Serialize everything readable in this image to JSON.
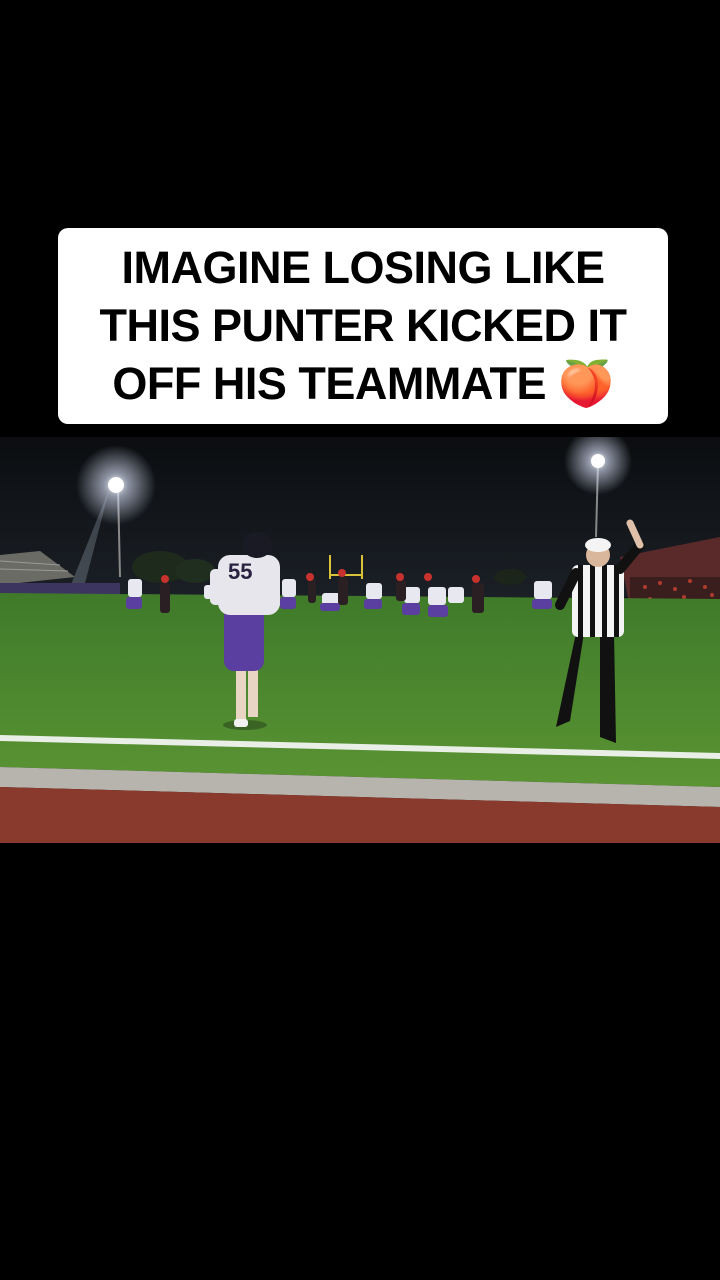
{
  "caption": {
    "text": "IMAGINE LOSING LIKE\nTHIS PUNTER KICKED IT\nOFF HIS TEAMMATE 🍑"
  },
  "video": {
    "description_icon": "video-frame",
    "punter_jersey_number": "55"
  },
  "colors": {
    "background": "#000000",
    "caption_bg": "#ffffff",
    "caption_text": "#000000",
    "turf": "#4f8a2e",
    "track": "#8a3a2c",
    "jersey_purple": "#5b3fa0"
  }
}
